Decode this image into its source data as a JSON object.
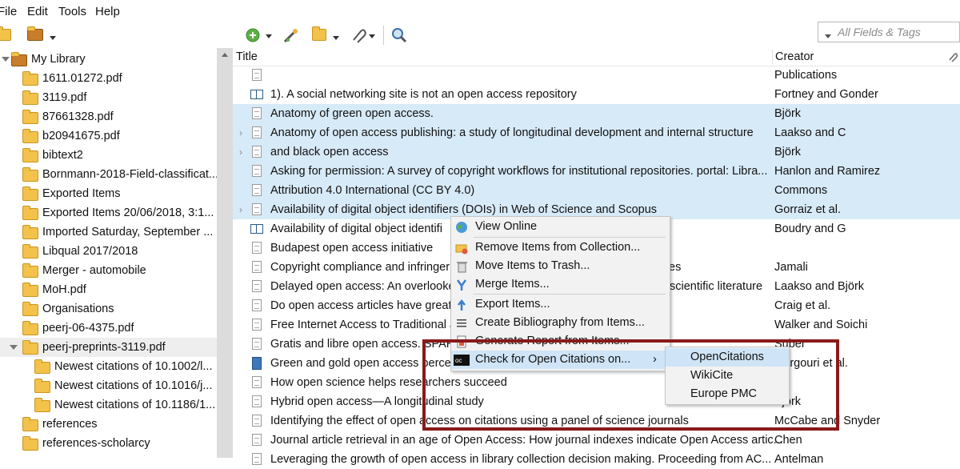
{
  "menubar": {
    "items": [
      "File",
      "Edit",
      "Tools",
      "Help"
    ]
  },
  "toolbar": {
    "search_placeholder": "All Fields & Tags"
  },
  "library": {
    "root": "My Library",
    "collections": [
      "1611.01272.pdf",
      "3119.pdf",
      "87661328.pdf",
      "b20941675.pdf",
      "bibtext2",
      "Bornmann-2018-Field-classificat...",
      "Exported Items",
      "Exported Items 20/06/2018, 3:1...",
      "Imported Saturday, September ...",
      "Libqual 2017/2018",
      "Merger - automobile",
      "MoH.pdf",
      "Organisations",
      "peerj-06-4375.pdf",
      "peerj-preprints-3119.pdf"
    ],
    "subcollections": [
      "Newest citations of 10.1002/l...",
      "Newest citations of 10.1016/j...",
      "Newest citations of 10.1186/1..."
    ],
    "after": [
      "references",
      "references-scholarcy"
    ]
  },
  "columns": {
    "title": "Title",
    "creator": "Creator"
  },
  "items": [
    {
      "title": "",
      "creator": "Publications"
    },
    {
      "title": "1). A social networking site is not an open access repository",
      "creator": "Fortney and Gonder"
    },
    {
      "title": "Anatomy of green open access.",
      "creator": "Björk"
    },
    {
      "title": "Anatomy of open access publishing: a study of longitudinal development and internal structure",
      "creator": "Laakso and C"
    },
    {
      "title": "and black open access",
      "creator": "Björk"
    },
    {
      "title": "Asking for permission: A survey of copyright workflows for institutional repositories. portal: Libra...",
      "creator": "Hanlon and Ramirez"
    },
    {
      "title": "Attribution 4.0 International (CC BY 4.0)",
      "creator": "Commons"
    },
    {
      "title": "Availability of digital object identifiers (DOIs) in Web of Science and Scopus",
      "creator": "Gorraiz et al."
    },
    {
      "title": "Availability of digital object identifi",
      "creator": "Boudry and G"
    },
    {
      "title": "Budapest open access initiative",
      "creator": ""
    },
    {
      "title": "Copyright compliance and infringer",
      "creator": "Jamali",
      "tail": "es"
    },
    {
      "title": "Delayed open access: An overlooke",
      "creator": "Laakso and Björk",
      "tail": "scientific literature"
    },
    {
      "title": "Do open access articles have greate",
      "creator": "Craig et al."
    },
    {
      "title": "Free Internet Access to Traditional J",
      "creator": "Walker and Soichi"
    },
    {
      "title": "Gratis and libre open access. SPARC",
      "creator": "Suber"
    },
    {
      "title": "Green and gold open access percer",
      "creator": "Gargouri et al."
    },
    {
      "title": "How open science helps researchers succeed",
      "creator": ""
    },
    {
      "title": "Hybrid open access—A longitudinal study",
      "creator": "Björk"
    },
    {
      "title": "Identifying the effect of open access on citations using a panel of science journals",
      "creator": "McCabe and Snyder"
    },
    {
      "title": "Journal article retrieval in an age of Open Access: How journal indexes indicate Open Access artic...",
      "creator": "Chen"
    },
    {
      "title": "Leveraging the growth of open access in library collection decision making. Proceeding from AC...",
      "creator": "Antelman"
    }
  ],
  "context_menu": {
    "items": [
      "View Online",
      "Remove Items from Collection...",
      "Move Items to Trash...",
      "Merge Items...",
      "Export Items...",
      "Create Bibliography from Items...",
      "Generate Report from Items...",
      "Check for Open Citations on..."
    ],
    "submenu": [
      "OpenCitations",
      "WikiCite",
      "Europe PMC"
    ]
  },
  "colors": {
    "selection": "#d7eaf8",
    "highlight_box": "#8a1a1a",
    "menu_hover": "#cfe5f7"
  }
}
